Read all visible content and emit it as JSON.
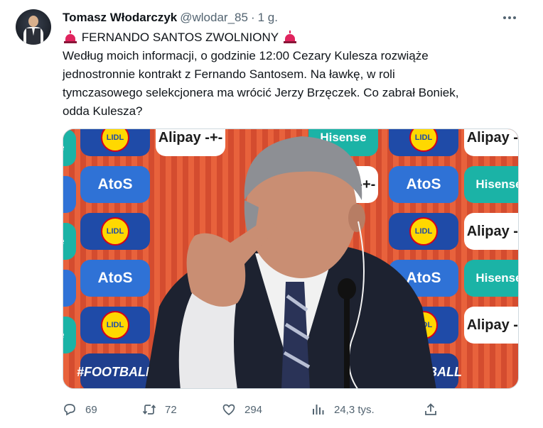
{
  "tweet": {
    "author_name": "Tomasz Włodarczyk",
    "handle": "@wlodar_85",
    "separator": "·",
    "time": "1 g.",
    "text_lines": [
      "FERNANDO SANTOS ZWOLNIONY",
      "Według moich informacji, o godzinie 12:00 Cezary Kulesza rozwiąże",
      "jednostronnie kontrakt z Fernando Santosem. Na ławkę, w roli",
      "tymczasowego selekcjonera ma wrócić Jerzy Brzęczek. Co zabrał Boniek,",
      "odda Kulesza?"
    ]
  },
  "media": {
    "sponsors": {
      "atos": "AtoS",
      "alipay": "Alipay -+-",
      "hisense": "Hisense",
      "lidl": "LIDL",
      "football": "#FOOTBALL"
    }
  },
  "actions": {
    "replies": "69",
    "retweets": "72",
    "likes": "294",
    "views": "24,3 tys."
  },
  "icons": [
    "avatar",
    "siren-icon",
    "more-icon",
    "reply-icon",
    "retweet-icon",
    "like-icon",
    "views-icon",
    "share-icon"
  ],
  "colors": {
    "text": "#0f1419",
    "secondary": "#536471",
    "siren": "#e0245e"
  }
}
